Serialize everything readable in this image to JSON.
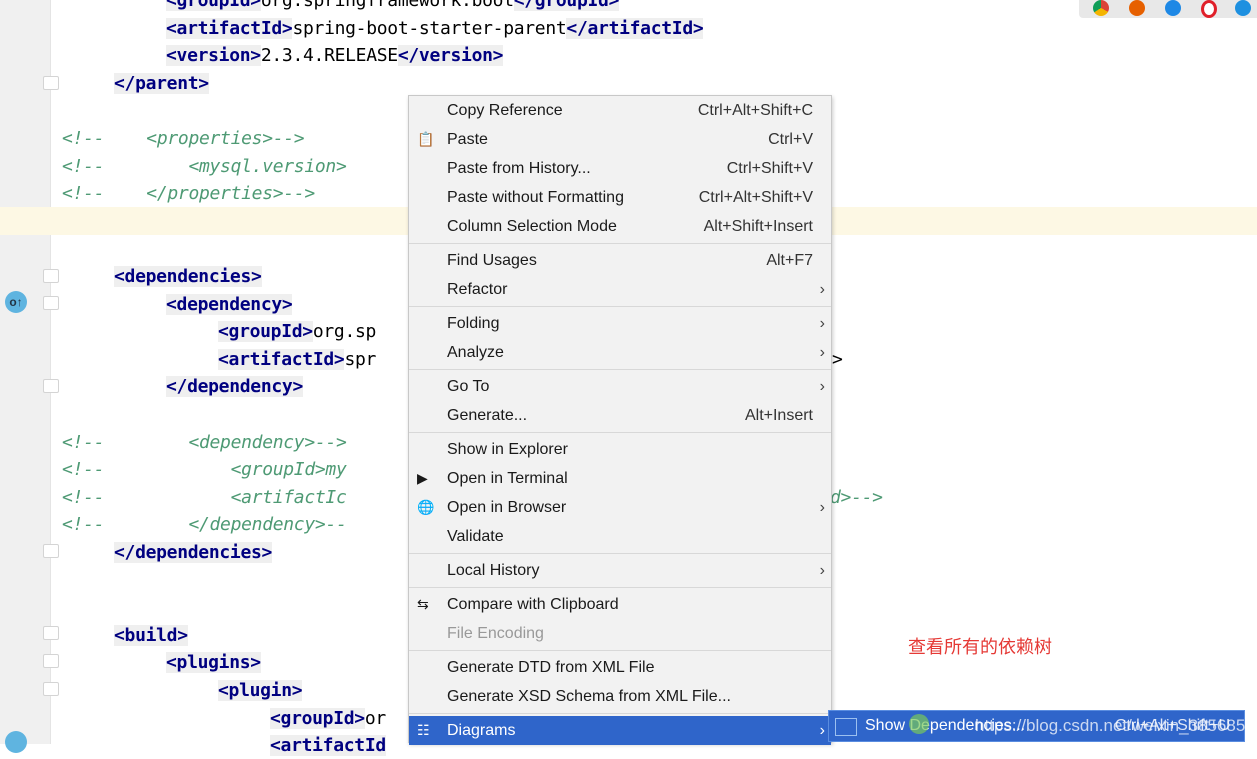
{
  "editor": {
    "lines": [
      {
        "t": 0,
        "lvl": 2,
        "parts": [
          [
            "tag",
            "<groupId>"
          ],
          [
            "",
            "org.springframework.boot"
          ],
          [
            "tag",
            "</groupId>"
          ]
        ]
      },
      {
        "t": 1,
        "lvl": 2,
        "parts": [
          [
            "tag",
            "<artifactId>"
          ],
          [
            "",
            "spring-boot-starter-parent"
          ],
          [
            "tag",
            "</artifactId>"
          ]
        ]
      },
      {
        "t": 2,
        "lvl": 2,
        "parts": [
          [
            "tag",
            "<version>"
          ],
          [
            "",
            "2.3.4.RELEASE"
          ],
          [
            "tag",
            "</version>"
          ]
        ]
      },
      {
        "t": 3,
        "lvl": 1,
        "parts": [
          [
            "tag",
            "</parent>"
          ]
        ]
      },
      {
        "t": 5,
        "lvl": 0,
        "parts": [
          [
            "cmt",
            "<!--    <properties>-->"
          ]
        ]
      },
      {
        "t": 6,
        "lvl": 0,
        "parts": [
          [
            "cmt",
            "<!--        <mysql.version>"
          ]
        ]
      },
      {
        "t": 7,
        "lvl": 0,
        "parts": [
          [
            "cmt",
            "<!--    </properties>-->"
          ]
        ]
      },
      {
        "t": 10,
        "lvl": 1,
        "parts": [
          [
            "tag",
            "<dependencies>"
          ]
        ]
      },
      {
        "t": 11,
        "lvl": 2,
        "parts": [
          [
            "tag",
            "<dependency>"
          ]
        ]
      },
      {
        "t": 12,
        "lvl": 3,
        "parts": [
          [
            "tag",
            "<groupId>"
          ],
          [
            "",
            "org.sp"
          ]
        ]
      },
      {
        "t": 13,
        "lvl": 3,
        "parts": [
          [
            "tag",
            "<artifactId>"
          ],
          [
            "",
            "spr"
          ]
        ]
      },
      {
        "t": 14,
        "lvl": 2,
        "parts": [
          [
            "tag",
            "</dependency>"
          ]
        ]
      },
      {
        "t": 16,
        "lvl": 0,
        "parts": [
          [
            "cmt",
            "<!--        <dependency>-->"
          ]
        ]
      },
      {
        "t": 17,
        "lvl": 0,
        "parts": [
          [
            "cmt",
            "<!--            <groupId>my"
          ]
        ]
      },
      {
        "t": 18,
        "lvl": 0,
        "parts": [
          [
            "cmt",
            "<!--            <artifactIc"
          ]
        ]
      },
      {
        "t": 19,
        "lvl": 0,
        "parts": [
          [
            "cmt",
            "<!--        </dependency>--"
          ]
        ]
      },
      {
        "t": 20,
        "lvl": 1,
        "parts": [
          [
            "tag",
            "</dependencies>"
          ]
        ]
      },
      {
        "t": 23,
        "lvl": 1,
        "parts": [
          [
            "tag",
            "<build>"
          ]
        ]
      },
      {
        "t": 24,
        "lvl": 2,
        "parts": [
          [
            "tag",
            "<plugins>"
          ]
        ]
      },
      {
        "t": 25,
        "lvl": 3,
        "parts": [
          [
            "tag",
            "<plugin>"
          ]
        ]
      },
      {
        "t": 26,
        "lvl": 4,
        "parts": [
          [
            "tag",
            "<groupId>"
          ],
          [
            "",
            "or"
          ]
        ]
      },
      {
        "t": 27,
        "lvl": 4,
        "parts": [
          [
            "tag",
            "<artifactId"
          ]
        ]
      }
    ],
    "fragments": [
      {
        "t": 13,
        "text": ">"
      },
      {
        "t": 18,
        "text": "d>-->"
      }
    ]
  },
  "context_menu": [
    {
      "label": "Copy Reference",
      "shortcut": "Ctrl+Alt+Shift+C"
    },
    {
      "label": "Paste",
      "shortcut": "Ctrl+V",
      "icon": "clipboard-icon"
    },
    {
      "label": "Paste from History...",
      "shortcut": "Ctrl+Shift+V"
    },
    {
      "label": "Paste without Formatting",
      "shortcut": "Ctrl+Alt+Shift+V"
    },
    {
      "label": "Column Selection Mode",
      "shortcut": "Alt+Shift+Insert"
    },
    {
      "sep": true
    },
    {
      "label": "Find Usages",
      "shortcut": "Alt+F7"
    },
    {
      "label": "Refactor",
      "submenu": true
    },
    {
      "sep": true
    },
    {
      "label": "Folding",
      "submenu": true
    },
    {
      "label": "Analyze",
      "submenu": true
    },
    {
      "sep": true
    },
    {
      "label": "Go To",
      "submenu": true
    },
    {
      "label": "Generate...",
      "shortcut": "Alt+Insert"
    },
    {
      "sep": true
    },
    {
      "label": "Show in Explorer"
    },
    {
      "label": "Open in Terminal",
      "icon": "terminal-icon"
    },
    {
      "label": "Open in Browser",
      "submenu": true,
      "icon": "globe-icon"
    },
    {
      "label": "Validate"
    },
    {
      "sep": true
    },
    {
      "label": "Local History",
      "submenu": true
    },
    {
      "sep": true
    },
    {
      "label": "Compare with Clipboard",
      "icon": "compare-icon"
    },
    {
      "label": "File Encoding",
      "disabled": true
    },
    {
      "sep": true
    },
    {
      "label": "Generate DTD from XML File"
    },
    {
      "label": "Generate XSD Schema from XML File..."
    },
    {
      "sep": true
    },
    {
      "label": "Diagrams",
      "submenu": true,
      "selected": true,
      "icon": "diagram-icon"
    }
  ],
  "submenu": {
    "label": "Show Dependencies...",
    "shortcut": "Ctrl+Alt+Shift+U"
  },
  "watermark": "https://blog.csdn.net/weixin_38568503",
  "annotation": "查看所有的依赖树",
  "colors": {
    "accent": "#2f65ca",
    "annotation": "#e53935",
    "tag": "#000080",
    "comment": "#4e9a74"
  }
}
